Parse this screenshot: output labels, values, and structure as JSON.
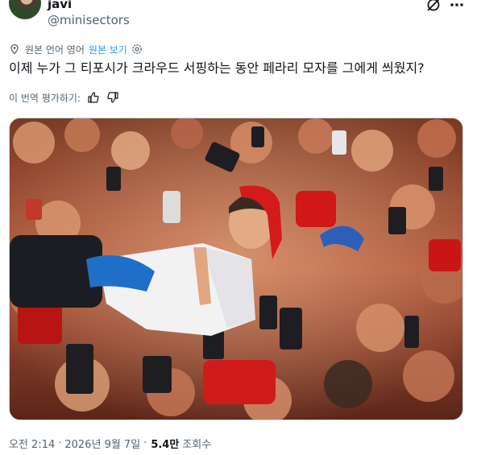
{
  "author": {
    "name": "javi",
    "handle": "@minisectors"
  },
  "translation": {
    "notice": "원본 언어 영어",
    "show_original": "원본 보기"
  },
  "tweet": {
    "text": "이제 누가 그 티포시가 크라우드 서핑하는 동안 페라리 모자를 그에게 씌웠지?"
  },
  "rating": {
    "label": "이 번역 평가하기:"
  },
  "meta": {
    "time": "오전 2:14",
    "separator": "·",
    "date": "2026년 9월 7일",
    "views": "5.4만",
    "views_label": "조회수"
  },
  "icons": {
    "grok": "grok-icon",
    "more": "more-icon",
    "translate": "translate-icon",
    "settings": "gear-icon",
    "thumbs_up": "thumbs-up-icon",
    "thumbs_down": "thumbs-down-icon"
  },
  "colors": {
    "accent": "#1d9bf0",
    "secondary_text": "#536471",
    "text": "#0f1419"
  }
}
